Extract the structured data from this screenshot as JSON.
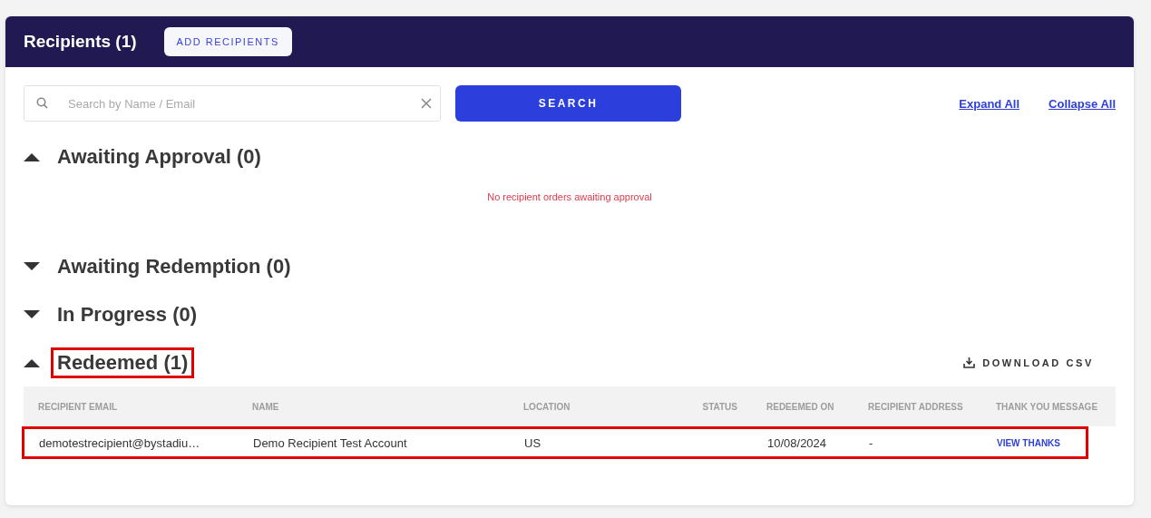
{
  "header": {
    "title": "Recipients (1)",
    "add_button": "ADD RECIPIENTS"
  },
  "search": {
    "placeholder": "Search by Name / Email",
    "button": "SEARCH"
  },
  "links": [
    "Expand All",
    "Collapse All"
  ],
  "sections": [
    {
      "title": "Awaiting Approval (0)",
      "expanded": true,
      "highlighted": false,
      "empty_message": "No recipient orders awaiting approval"
    },
    {
      "title": "Awaiting Redemption (0)",
      "expanded": false,
      "highlighted": false
    },
    {
      "title": "In Progress (0)",
      "expanded": false,
      "highlighted": false
    },
    {
      "title": "Redeemed (1)",
      "expanded": true,
      "highlighted": true,
      "action": "DOWNLOAD CSV",
      "table": {
        "columns": [
          "RECIPIENT EMAIL",
          "NAME",
          "LOCATION",
          "STATUS",
          "REDEEMED ON",
          "RECIPIENT ADDRESS",
          "THANK YOU MESSAGE"
        ],
        "rows": [
          {
            "highlighted": true,
            "email": "demotestrecipient@bystadiu…",
            "name": "Demo Recipient Test Account",
            "location": "US",
            "redeemed_on": "10/08/2024",
            "address": "-",
            "thanks_link": "VIEW THANKS"
          }
        ]
      }
    }
  ]
}
